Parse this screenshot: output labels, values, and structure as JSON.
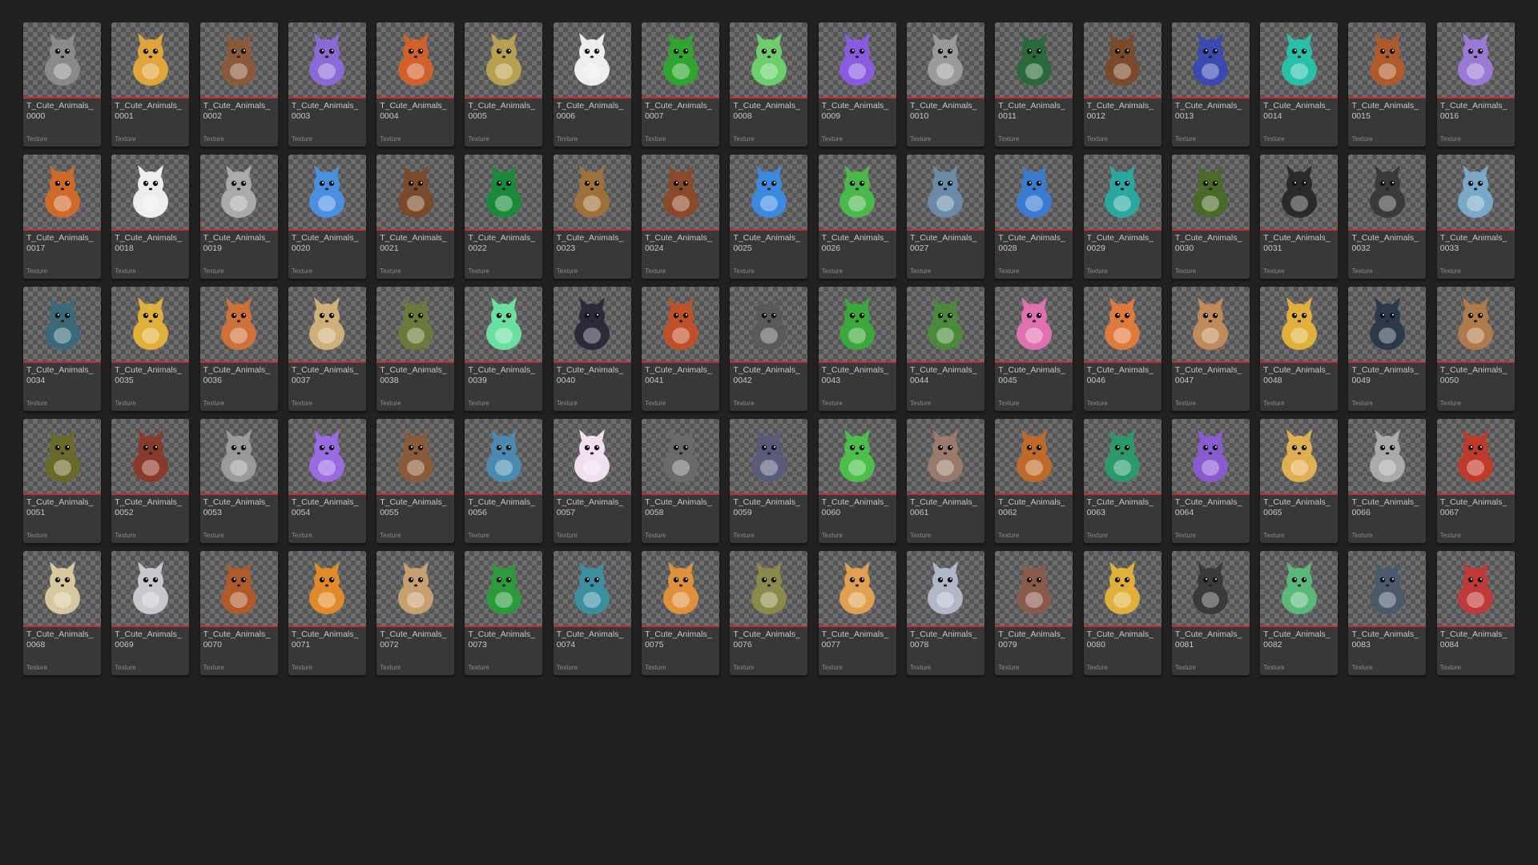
{
  "asset_type_label": "Texture",
  "assets": [
    {
      "name": "T_Cute_Animals_\n0000",
      "icon": "raccoon-icon",
      "color": "#8a8a8a"
    },
    {
      "name": "T_Cute_Animals_\n0001",
      "icon": "giraffe-icon",
      "color": "#e0a43a"
    },
    {
      "name": "T_Cute_Animals_\n0002",
      "icon": "sloth-icon",
      "color": "#8a5a3a"
    },
    {
      "name": "T_Cute_Animals_\n0003",
      "icon": "hamster-icon",
      "color": "#8a6ad6"
    },
    {
      "name": "T_Cute_Animals_\n0004",
      "icon": "fox-icon",
      "color": "#d2602a"
    },
    {
      "name": "T_Cute_Animals_\n0005",
      "icon": "chicken-icon",
      "color": "#b8a050"
    },
    {
      "name": "T_Cute_Animals_\n0006",
      "icon": "polar-bear-icon",
      "color": "#eeeeee"
    },
    {
      "name": "T_Cute_Animals_\n0007",
      "icon": "snake-icon",
      "color": "#2fa52f"
    },
    {
      "name": "T_Cute_Animals_\n0008",
      "icon": "frog-blob-icon",
      "color": "#6ccf6c"
    },
    {
      "name": "T_Cute_Animals_\n0009",
      "icon": "bird-icon",
      "color": "#8a5ae0"
    },
    {
      "name": "T_Cute_Animals_\n0010",
      "icon": "chinchilla-icon",
      "color": "#9a9a9a"
    },
    {
      "name": "T_Cute_Animals_\n0011",
      "icon": "bison-icon",
      "color": "#2a6a3a"
    },
    {
      "name": "T_Cute_Animals_\n0012",
      "icon": "bison-icon",
      "color": "#7a4a2a"
    },
    {
      "name": "T_Cute_Animals_\n0013",
      "icon": "penguin-icon",
      "color": "#3a4ab0"
    },
    {
      "name": "T_Cute_Animals_\n0014",
      "icon": "sheep-icon",
      "color": "#2ac0a8"
    },
    {
      "name": "T_Cute_Animals_\n0015",
      "icon": "deer-icon",
      "color": "#b05a2a"
    },
    {
      "name": "T_Cute_Animals_\n0016",
      "icon": "cat-icon",
      "color": "#9a7ad6"
    },
    {
      "name": "T_Cute_Animals_\n0017",
      "icon": "spider-icon",
      "color": "#d06a2a"
    },
    {
      "name": "T_Cute_Animals_\n0018",
      "icon": "goat-icon",
      "color": "#eeeeee"
    },
    {
      "name": "T_Cute_Animals_\n0019",
      "icon": "chinchilla-icon",
      "color": "#aaaaaa"
    },
    {
      "name": "T_Cute_Animals_\n0020",
      "icon": "horse-icon",
      "color": "#4a90e0"
    },
    {
      "name": "T_Cute_Animals_\n0021",
      "icon": "fish-icon",
      "color": "#7a4a2a"
    },
    {
      "name": "T_Cute_Animals_\n0022",
      "icon": "beetle-icon",
      "color": "#1a8a3a"
    },
    {
      "name": "T_Cute_Animals_\n0023",
      "icon": "sparrow-icon",
      "color": "#a0703a"
    },
    {
      "name": "T_Cute_Animals_\n0024",
      "icon": "owl-icon",
      "color": "#8a4a2a"
    },
    {
      "name": "T_Cute_Animals_\n0025",
      "icon": "fish-icon",
      "color": "#3a8ae0"
    },
    {
      "name": "T_Cute_Animals_\n0026",
      "icon": "frog-icon",
      "color": "#4ab84a"
    },
    {
      "name": "T_Cute_Animals_\n0027",
      "icon": "shark-icon",
      "color": "#6a8aa8"
    },
    {
      "name": "T_Cute_Animals_\n0028",
      "icon": "bluejay-icon",
      "color": "#3a7ad0"
    },
    {
      "name": "T_Cute_Animals_\n0029",
      "icon": "toad-icon",
      "color": "#2aa8a0"
    },
    {
      "name": "T_Cute_Animals_\n0030",
      "icon": "turtle-icon",
      "color": "#4a6a2a"
    },
    {
      "name": "T_Cute_Animals_\n0031",
      "icon": "bird-icon",
      "color": "#2a2a2a"
    },
    {
      "name": "T_Cute_Animals_\n0032",
      "icon": "goat-icon",
      "color": "#3a3a3a"
    },
    {
      "name": "T_Cute_Animals_\n0033",
      "icon": "pigeon-icon",
      "color": "#7aa8c8"
    },
    {
      "name": "T_Cute_Animals_\n0034",
      "icon": "duck-icon",
      "color": "#3a6a7a"
    },
    {
      "name": "T_Cute_Animals_\n0035",
      "icon": "fish-icon",
      "color": "#e0b03a"
    },
    {
      "name": "T_Cute_Animals_\n0036",
      "icon": "deer-icon",
      "color": "#d0703a"
    },
    {
      "name": "T_Cute_Animals_\n0037",
      "icon": "sheep-icon",
      "color": "#d0b07a"
    },
    {
      "name": "T_Cute_Animals_\n0038",
      "icon": "wombat-icon",
      "color": "#6a7a3a"
    },
    {
      "name": "T_Cute_Animals_\n0039",
      "icon": "chick-icon",
      "color": "#6ae0a0"
    },
    {
      "name": "T_Cute_Animals_\n0040",
      "icon": "rooster-icon",
      "color": "#2a2a3a"
    },
    {
      "name": "T_Cute_Animals_\n0041",
      "icon": "red-panda-icon",
      "color": "#c0502a"
    },
    {
      "name": "T_Cute_Animals_\n0042",
      "icon": "seal-icon",
      "color": "#5a5a5a"
    },
    {
      "name": "T_Cute_Animals_\n0043",
      "icon": "frog-icon",
      "color": "#3aa83a"
    },
    {
      "name": "T_Cute_Animals_\n0044",
      "icon": "sloth-icon",
      "color": "#4a8a3a"
    },
    {
      "name": "T_Cute_Animals_\n0045",
      "icon": "jellyfish-icon",
      "color": "#e070b0"
    },
    {
      "name": "T_Cute_Animals_\n0046",
      "icon": "deer-icon",
      "color": "#e07a3a"
    },
    {
      "name": "T_Cute_Animals_\n0047",
      "icon": "hamster-icon",
      "color": "#c08a5a"
    },
    {
      "name": "T_Cute_Animals_\n0048",
      "icon": "hamster-icon",
      "color": "#e0b03a"
    },
    {
      "name": "T_Cute_Animals_\n0049",
      "icon": "bison-icon",
      "color": "#2a3a4a"
    },
    {
      "name": "T_Cute_Animals_\n0050",
      "icon": "dog-icon",
      "color": "#b07a4a"
    },
    {
      "name": "T_Cute_Animals_\n0051",
      "icon": "toad-icon",
      "color": "#6a6a2a"
    },
    {
      "name": "T_Cute_Animals_\n0052",
      "icon": "turkey-icon",
      "color": "#8a3a2a"
    },
    {
      "name": "T_Cute_Animals_\n0053",
      "icon": "koala-icon",
      "color": "#9a9a9a"
    },
    {
      "name": "T_Cute_Animals_\n0054",
      "icon": "shark-icon",
      "color": "#9a6ae0"
    },
    {
      "name": "T_Cute_Animals_\n0055",
      "icon": "bear-icon",
      "color": "#8a5a3a"
    },
    {
      "name": "T_Cute_Animals_\n0056",
      "icon": "shark-icon",
      "color": "#4a8ab0"
    },
    {
      "name": "T_Cute_Animals_\n0057",
      "icon": "cat-icon",
      "color": "#f0e0f0"
    },
    {
      "name": "T_Cute_Animals_\n0058",
      "icon": "cat-icon",
      "color": "#6a6a6a"
    },
    {
      "name": "T_Cute_Animals_\n0059",
      "icon": "frog-icon",
      "color": "#5a5a7a"
    },
    {
      "name": "T_Cute_Animals_\n0060",
      "icon": "frog-icon",
      "color": "#4ac04a"
    },
    {
      "name": "T_Cute_Animals_\n0061",
      "icon": "sparrow-icon",
      "color": "#9a7a6a"
    },
    {
      "name": "T_Cute_Animals_\n0062",
      "icon": "fox-icon",
      "color": "#c06a2a"
    },
    {
      "name": "T_Cute_Animals_\n0063",
      "icon": "hippo-icon",
      "color": "#2a9a6a"
    },
    {
      "name": "T_Cute_Animals_\n0064",
      "icon": "monster-icon",
      "color": "#8a5ad0"
    },
    {
      "name": "T_Cute_Animals_\n0065",
      "icon": "camel-icon",
      "color": "#e0b050"
    },
    {
      "name": "T_Cute_Animals_\n0066",
      "icon": "koala-icon",
      "color": "#aaaaaa"
    },
    {
      "name": "T_Cute_Animals_\n0067",
      "icon": "fox-icon",
      "color": "#c03a2a"
    },
    {
      "name": "T_Cute_Animals_\n0068",
      "icon": "snake-icon",
      "color": "#d8c8a0"
    },
    {
      "name": "T_Cute_Animals_\n0069",
      "icon": "wolf-icon",
      "color": "#c8c8d0"
    },
    {
      "name": "T_Cute_Animals_\n0070",
      "icon": "fox-icon",
      "color": "#b05a2a"
    },
    {
      "name": "T_Cute_Animals_\n0071",
      "icon": "chick-icon",
      "color": "#e08a2a"
    },
    {
      "name": "T_Cute_Animals_\n0072",
      "icon": "deer-icon",
      "color": "#c8a070"
    },
    {
      "name": "T_Cute_Animals_\n0073",
      "icon": "duck-icon",
      "color": "#2a9a3a"
    },
    {
      "name": "T_Cute_Animals_\n0074",
      "icon": "manatee-icon",
      "color": "#3a90a0"
    },
    {
      "name": "T_Cute_Animals_\n0075",
      "icon": "snail-icon",
      "color": "#e0903a"
    },
    {
      "name": "T_Cute_Animals_\n0076",
      "icon": "fish-icon",
      "color": "#8a8a4a"
    },
    {
      "name": "T_Cute_Animals_\n0077",
      "icon": "bee-icon",
      "color": "#e0a050"
    },
    {
      "name": "T_Cute_Animals_\n0078",
      "icon": "dolphin-icon",
      "color": "#b0b8c8"
    },
    {
      "name": "T_Cute_Animals_\n0079",
      "icon": "hamster-icon",
      "color": "#8a5a4a"
    },
    {
      "name": "T_Cute_Animals_\n0080",
      "icon": "giraffe-icon",
      "color": "#e0b03a"
    },
    {
      "name": "T_Cute_Animals_\n0081",
      "icon": "mole-icon",
      "color": "#3a3a3a"
    },
    {
      "name": "T_Cute_Animals_\n0082",
      "icon": "dragon-icon",
      "color": "#5ab87a"
    },
    {
      "name": "T_Cute_Animals_\n0083",
      "icon": "bird-icon",
      "color": "#4a5a6a"
    },
    {
      "name": "T_Cute_Animals_\n0084",
      "icon": "yak-icon",
      "color": "#c03a3a"
    }
  ]
}
